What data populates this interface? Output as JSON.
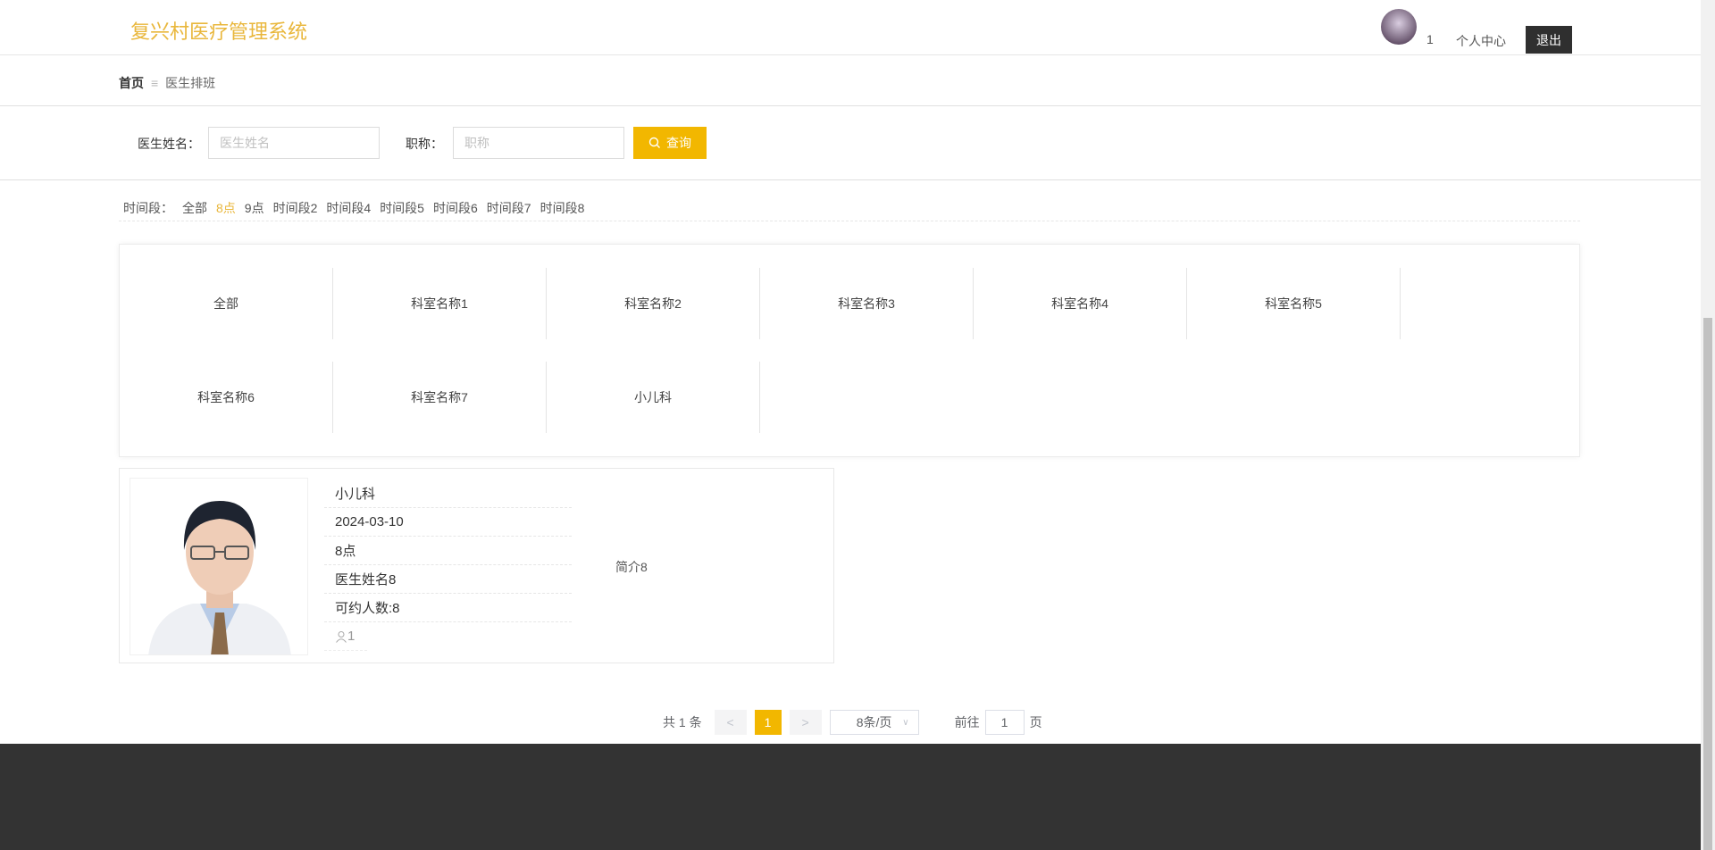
{
  "header": {
    "title": "复兴村医疗管理系统",
    "username": "1",
    "profile_label": "个人中心",
    "logout_label": "退出"
  },
  "breadcrumb": {
    "home": "首页",
    "separator": "≡",
    "current": "医生排班"
  },
  "search": {
    "name_label": "医生姓名：",
    "name_placeholder": "医生姓名",
    "name_value": "",
    "title_label": "职称：",
    "title_placeholder": "职称",
    "title_value": "",
    "button_label": "查询"
  },
  "time_slots": {
    "label": "时间段：",
    "items": [
      "全部",
      "8点",
      "9点",
      "时间段2",
      "时间段4",
      "时间段5",
      "时间段6",
      "时间段7",
      "时间段8"
    ],
    "active": "8点"
  },
  "departments": [
    "全部",
    "科室名称1",
    "科室名称2",
    "科室名称3",
    "科室名称4",
    "科室名称5",
    "科室名称6",
    "科室名称7",
    "小儿科"
  ],
  "schedule_card": {
    "department": "小儿科",
    "date": "2024-03-10",
    "time": "8点",
    "doctor": "医生姓名8",
    "capacity": "可约人数:8",
    "booked": "1",
    "intro": "简介8"
  },
  "pagination": {
    "total": "共 1 条",
    "prev": "<",
    "page": "1",
    "next": ">",
    "page_size": "8条/页",
    "goto_label": "前往",
    "goto_value": "1",
    "page_suffix": "页"
  },
  "colors": {
    "accent": "#f2b700",
    "title": "#e9b73c",
    "footer": "#333333"
  }
}
